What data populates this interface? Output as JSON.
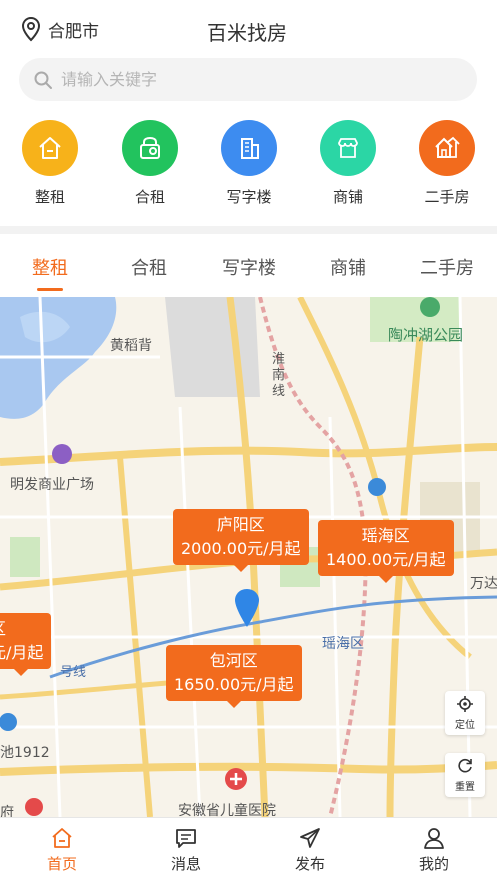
{
  "header": {
    "city": "合肥市",
    "title": "百米找房"
  },
  "search": {
    "placeholder": "请输入关键字"
  },
  "categories": [
    {
      "label": "整租",
      "icon": "house-icon",
      "color": "#f7b21a"
    },
    {
      "label": "合租",
      "icon": "shared-room-icon",
      "color": "#22c35e"
    },
    {
      "label": "写字楼",
      "icon": "office-building-icon",
      "color": "#3d8cf0"
    },
    {
      "label": "商铺",
      "icon": "shop-icon",
      "color": "#2bd6a5"
    },
    {
      "label": "二手房",
      "icon": "second-hand-house-icon",
      "color": "#f26b1d"
    }
  ],
  "tabs": {
    "items": [
      "整租",
      "合租",
      "写字楼",
      "商铺",
      "二手房"
    ],
    "active": "整租"
  },
  "map": {
    "labels": {
      "park": "陶冲湖公园",
      "huangdaobei": "黄稻背",
      "huainan_line": "淮南线",
      "mingfa": "明发商业广场",
      "baohe_station": "包河区",
      "yaohai_station": "瑶海区",
      "wanda": "万达",
      "line": "号线",
      "hefei1912": "池1912",
      "hospital": "安徽省儿童医院",
      "fu": "府"
    },
    "pins": [
      {
        "district": "庐阳区",
        "price": "2000.00元/月起"
      },
      {
        "district": "瑶海区",
        "price": "1400.00元/月起"
      },
      {
        "district": "包河区",
        "price": "1650.00元/月起"
      },
      {
        "district": "区",
        "price": "元/月起"
      }
    ],
    "buttons": {
      "locate": "定位",
      "reset": "重置"
    }
  },
  "nav": {
    "items": [
      {
        "label": "首页",
        "icon": "home-icon"
      },
      {
        "label": "消息",
        "icon": "message-icon"
      },
      {
        "label": "发布",
        "icon": "send-icon"
      },
      {
        "label": "我的",
        "icon": "profile-icon"
      }
    ],
    "active": "首页"
  },
  "colors": {
    "accent": "#f26b1d"
  }
}
